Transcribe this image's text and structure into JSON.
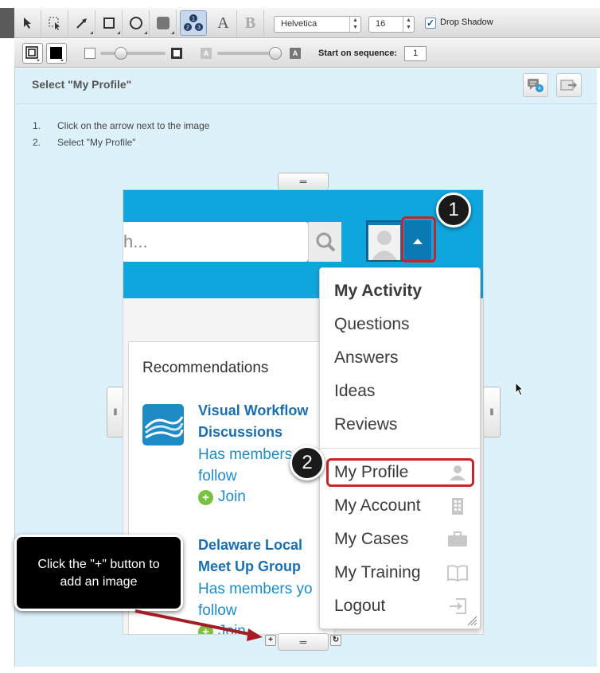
{
  "toolbar": {
    "font_family": "Helvetica",
    "font_size": "16",
    "drop_shadow_label": "Drop Shadow",
    "drop_shadow_checked": true,
    "tool_text_label": "A",
    "tool_bold_label": "B",
    "sequence_label": "Start on sequence:",
    "sequence_value": "1",
    "opacity_letter": "A"
  },
  "step": {
    "title": "Select \"My Profile\"",
    "instructions": [
      {
        "num": "1.",
        "text": "Click on the arrow next to the image"
      },
      {
        "num": "2.",
        "text": "Select \"My Profile\""
      }
    ]
  },
  "handles": {
    "top": "═",
    "left": "‖",
    "right": "‖",
    "bottom": "═",
    "plus": "+",
    "refresh": "↻"
  },
  "screenshot": {
    "search_placeholder": "h...",
    "recommendations_title": "Recommendations",
    "recommendations": [
      {
        "name_line1": "Visual Workflow",
        "name_line2": "Discussions",
        "meta_line1": "Has members",
        "meta_line2": "follow",
        "join": "Join"
      },
      {
        "name_line1": "Delaware Local",
        "name_line2": "Meet Up Group",
        "meta_line1": "Has members yo",
        "meta_line2": "follow",
        "join": "Join"
      }
    ],
    "menu": {
      "heading": "My Activity",
      "activity_items": [
        "Questions",
        "Answers",
        "Ideas",
        "Reviews"
      ],
      "account_items": [
        {
          "label": "My Profile",
          "icon": "person-icon"
        },
        {
          "label": "My Account",
          "icon": "building-icon"
        },
        {
          "label": "My Cases",
          "icon": "briefcase-icon"
        },
        {
          "label": "My Training",
          "icon": "book-icon"
        },
        {
          "label": "Logout",
          "icon": "logout-icon"
        }
      ]
    }
  },
  "annotations": {
    "badge1": "1",
    "badge2": "2",
    "callout_line1": "Click the \"+\" button to",
    "callout_line2": "add an image"
  },
  "colors": {
    "page_bg": "#ddf1fb",
    "header_blue": "#0fa6de",
    "link_blue": "#1b6fae",
    "highlight_red": "#c4262b",
    "arrow_red": "#a51c24"
  }
}
